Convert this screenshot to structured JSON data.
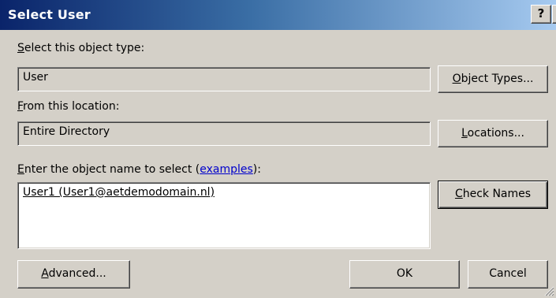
{
  "window": {
    "title": "Select User",
    "help_label": "?",
    "close_label": "X"
  },
  "object_type": {
    "label_hotkey": "S",
    "label_rest": "elect this object type:",
    "value": "User",
    "button_hotkey": "O",
    "button_rest": "bject Types..."
  },
  "location": {
    "label_hotkey": "F",
    "label_rest": "rom this location:",
    "value": "Entire Directory",
    "button_hotkey": "L",
    "button_rest": "ocations..."
  },
  "object_name": {
    "label_hotkey": "E",
    "label_rest": "nter the object name to select (",
    "examples_link": "examples",
    "label_end": "):",
    "value": "User1 (User1@aetdemodomain.nl)",
    "check_hotkey": "C",
    "check_rest": "heck Names"
  },
  "footer": {
    "advanced_hotkey": "A",
    "advanced_rest": "dvanced...",
    "ok_label": "OK",
    "cancel_label": "Cancel"
  },
  "colors": {
    "face": "#d4d0c8",
    "title_start": "#0a246a",
    "title_end": "#a6caf0",
    "link": "#0000cc"
  }
}
